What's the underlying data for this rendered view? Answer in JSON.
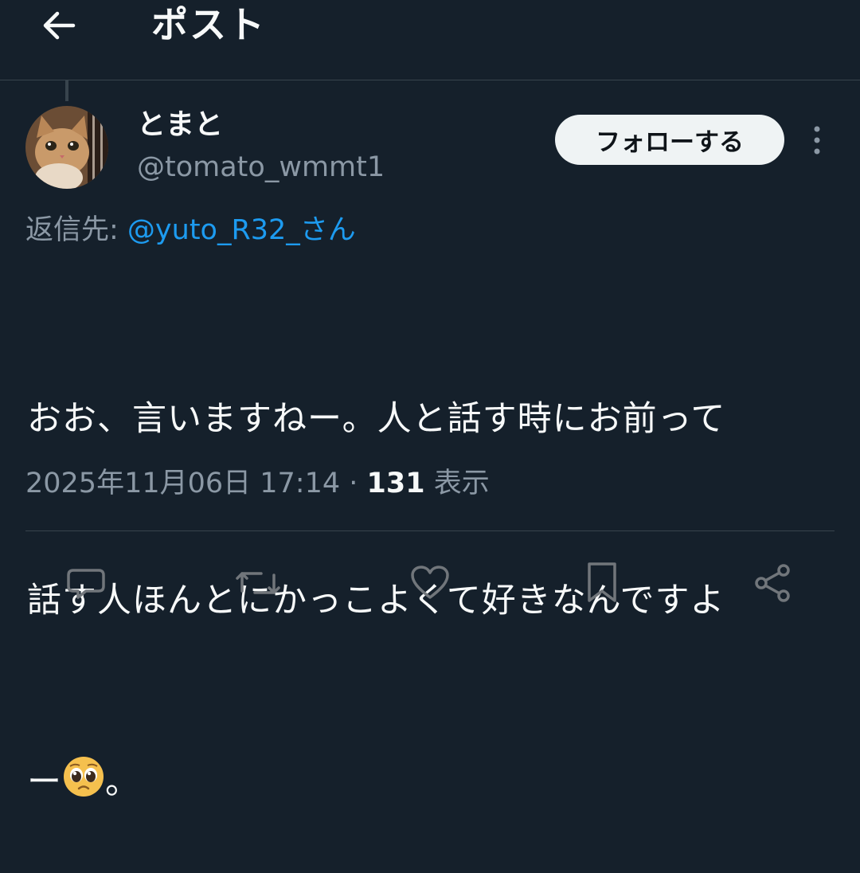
{
  "header": {
    "title": "ポスト",
    "back_icon": "arrow-left-icon"
  },
  "user": {
    "name": "とまと",
    "handle": "@tomato_wmmt1",
    "avatar": "cat-avatar"
  },
  "follow_label": "フォローする",
  "reply": {
    "prefix": "返信先: ",
    "mention": "@yuto_R32_さん"
  },
  "tweet": {
    "text_line1": "おお、言いますねー。人と話す時にお前って",
    "text_line2": "話す人ほんとにかっこよくて好きなんですよ",
    "text_line3_before": "ー",
    "emoji": "pleading-face-emoji",
    "text_line3_after": "。"
  },
  "meta": {
    "datetime": "2025年11月06日 17:14",
    "separator": " · ",
    "views_count": "131",
    "views_label": " 表示"
  },
  "actions": [
    "reply-icon",
    "retweet-icon",
    "like-icon",
    "bookmark-icon",
    "share-icon"
  ],
  "colors": {
    "background": "#15202b",
    "text": "#f7f9f9",
    "secondary": "#8b98a5",
    "link": "#1d9bf0",
    "border": "#38444d",
    "follow_bg": "#eff3f4"
  }
}
